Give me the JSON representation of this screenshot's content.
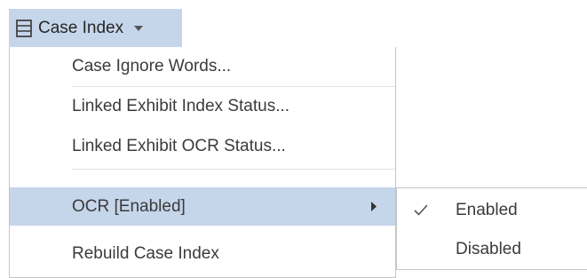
{
  "toolbar": {
    "icon": "index-icon",
    "label": "Case Index",
    "caret_icon": "caret-down-icon"
  },
  "menu": {
    "items": [
      {
        "label": "Case Ignore Words..."
      },
      {
        "label": "Linked Exhibit Index Status..."
      },
      {
        "label": "Linked Exhibit OCR Status..."
      },
      {
        "label": "OCR [Enabled]",
        "has_submenu": true,
        "selected": true
      },
      {
        "label": "Rebuild Case Index"
      }
    ]
  },
  "submenu": {
    "items": [
      {
        "label": "Enabled",
        "checked": true
      },
      {
        "label": "Disabled",
        "checked": false
      }
    ]
  },
  "colors": {
    "highlight": "#c5d5ea",
    "border": "#c6c6c6",
    "text": "#3b3b3b"
  }
}
